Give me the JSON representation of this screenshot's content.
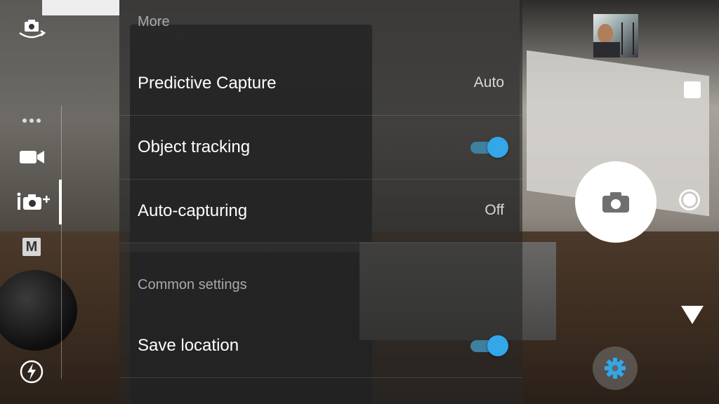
{
  "settings": {
    "section_more": "More",
    "predictive_capture": {
      "label": "Predictive Capture",
      "value": "Auto"
    },
    "object_tracking": {
      "label": "Object tracking",
      "enabled": true
    },
    "auto_capturing": {
      "label": "Auto-capturing",
      "value": "Off"
    },
    "section_common": "Common settings",
    "save_location": {
      "label": "Save location",
      "enabled": true
    }
  },
  "left_modes": {
    "items": [
      "switch-camera-icon",
      "more-modes-icon",
      "video-camera-icon",
      "superior-auto-icon",
      "manual-mode-icon",
      "flash-auto-icon"
    ],
    "manual_label": "M",
    "active": "superior-auto-icon"
  },
  "colors": {
    "accent": "#33a7e8",
    "text_primary": "#ffffff",
    "text_secondary": "#a9a9a9"
  },
  "right_controls": {
    "icons": [
      "thumbnail-preview",
      "stop-icon",
      "shutter-camera-icon",
      "record-icon",
      "collapse-icon",
      "settings-gear-icon"
    ]
  }
}
